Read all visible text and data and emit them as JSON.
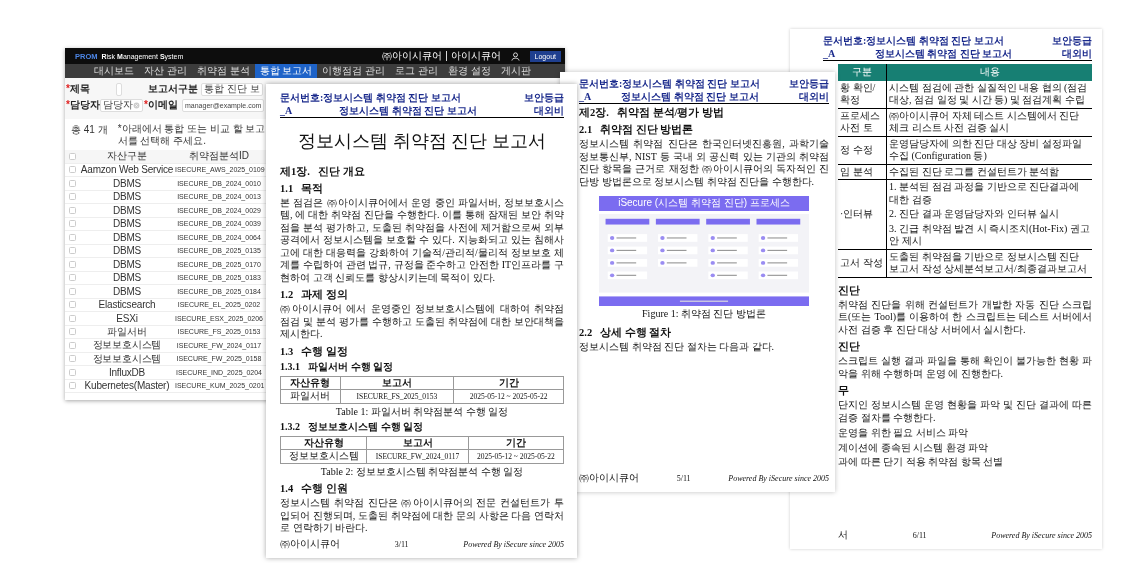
{
  "app": {
    "brand": "PROM",
    "title": "**R**isk **M**anagement **S**ystem",
    "user": "㈜아이시큐어 | 아이시큐어",
    "logout": "Logout",
    "nav": [
      {
        "label": "대시보드",
        "selected": false
      },
      {
        "label": "자산 관리",
        "selected": false
      },
      {
        "label": "취약점 분석",
        "selected": false
      },
      {
        "label": "통합 보고서",
        "selected": true
      },
      {
        "label": "이행점검 관리",
        "selected": false
      },
      {
        "label": "로그 관리",
        "selected": false
      },
      {
        "label": "환경 설정",
        "selected": false
      },
      {
        "label": "게시판",
        "selected": false
      }
    ],
    "form": [
      [
        {
          "mark": "*",
          "label": "제목",
          "kind": "input"
        },
        {
          "label": "보고서구분",
          "kind": "select",
          "value": "통합 진단 보"
        }
      ],
      [
        {
          "mark": "*",
          "label": "담당자",
          "kind": "clearable",
          "value": "담당자"
        },
        {
          "mark": "*",
          "label": "이메일",
          "kind": "input",
          "value": "manager@example.com"
        }
      ]
    ],
    "count": "총 41 개",
    "hint": "*아래에서 통합 또는 비교 할 보고서를 선택해 주세요.",
    "select_all": {
      "checked": false
    },
    "columns": [
      "자산구분",
      "취약점분석ID"
    ],
    "rows": [
      {
        "checked": false,
        "asset": "Aamzon Web Service",
        "id": "ISECURE_AWS_2025_0109"
      },
      {
        "checked": false,
        "asset": "DBMS",
        "id": "ISECURE_DB_2024_0010"
      },
      {
        "checked": false,
        "asset": "DBMS",
        "id": "ISECURE_DB_2024_0013"
      },
      {
        "checked": false,
        "asset": "DBMS",
        "id": "ISECURE_DB_2024_0029"
      },
      {
        "checked": false,
        "asset": "DBMS",
        "id": "ISECURE_DB_2024_0039"
      },
      {
        "checked": false,
        "asset": "DBMS",
        "id": "ISECURE_DB_2024_0064"
      },
      {
        "checked": false,
        "asset": "DBMS",
        "id": "ISECURE_DB_2025_0135"
      },
      {
        "checked": false,
        "asset": "DBMS",
        "id": "ISECURE_DB_2025_0170"
      },
      {
        "checked": false,
        "asset": "DBMS",
        "id": "ISECURE_DB_2025_0183"
      },
      {
        "checked": false,
        "asset": "DBMS",
        "id": "ISECURE_DB_2025_0184"
      },
      {
        "checked": false,
        "asset": "Elasticsearch",
        "id": "ISECURE_EL_2025_0202"
      },
      {
        "checked": false,
        "asset": "ESXi",
        "id": "ISECURE_ESX_2025_0206"
      },
      {
        "checked": false,
        "asset": "파일서버",
        "id": "ISECURE_FS_2025_0153"
      },
      {
        "checked": false,
        "asset": "정보보호시스템",
        "id": "ISECURE_FW_2024_0117"
      },
      {
        "checked": false,
        "asset": "정보보호시스템",
        "id": "ISECURE_FW_2025_0158"
      },
      {
        "checked": false,
        "asset": "InfluxDB",
        "id": "ISECURE_IND_2025_0204"
      },
      {
        "checked": false,
        "asset": "Kubernetes(Master)",
        "id": "ISECURE_KUM_2025_0201"
      }
    ]
  },
  "pages": [
    {
      "header": {
        "doc_no": "문서번호:정보시스템 취약점 진단 보고서",
        "doc_suffix": "_A",
        "doc_title": "정보시스템 취약점 진단 보고서",
        "grade_label": "보안등급",
        "grade": "대외비"
      },
      "title": "정보시스템 취약점 진단 보고서",
      "blocks": [
        {
          "kind": "chapter",
          "num": "제1장.",
          "text": "진단 개요"
        },
        {
          "kind": "section",
          "num": "1.1",
          "text": "목적"
        },
        {
          "kind": "para",
          "text": "본 점검은 ㈜아이시큐어에서 운영 중인 파일서버, 정보보호시스템, 에 대한 취약점 진단을 수행한다. 이를 통해 잠재된 보안 취약점을 분석 평가하고, 도출된 취약점을 사전에 제거함으로써 외부 공격에서 정보시스템을 보호할 수 있다. 지능화되고 있는 침해사고에 대한 대응력을 강화하여 기술적/관리적/물리적 정보보호 체계를 수립하여 관련 법규, 규정을 준수하고 안전한 IT인프라를 구현하여 고객 신뢰도를 향상시키는데 목적이 있다."
        },
        {
          "kind": "section",
          "num": "1.2",
          "text": "과제 정의"
        },
        {
          "kind": "para",
          "text": "㈜아이시큐어 에서 운영중인 정보보호시스템에 대하여 취약점 점검 및 분석 평가를 수행하고 도출된 취약점에 대한 보안대책을 제시한다."
        },
        {
          "kind": "section",
          "num": "1.3",
          "text": "수행 일정"
        },
        {
          "kind": "subsection",
          "num": "1.3.1",
          "text": "파일서버 수행 일정"
        },
        {
          "kind": "table",
          "columns": [
            "자산유형",
            "보고서",
            "기간"
          ],
          "rows": [
            [
              "파일서버",
              "ISECURE_FS_2025_0153",
              "2025-05-12 ~ 2025-05-22"
            ]
          ],
          "caption": "Table 1: 파일서버 취약점분석 수행 일정"
        },
        {
          "kind": "subsection",
          "num": "1.3.2",
          "text": "정보보호시스템 수행 일정"
        },
        {
          "kind": "table",
          "columns": [
            "자산유형",
            "보고서",
            "기간"
          ],
          "rows": [
            [
              "정보보호시스템",
              "ISECURE_FW_2024_0117",
              "2025-05-12 ~ 2025-05-22"
            ]
          ],
          "caption": "Table 2: 정보보호시스템 취약점분석 수행 일정"
        },
        {
          "kind": "section",
          "num": "1.4",
          "text": "수행 인원"
        },
        {
          "kind": "para",
          "text": "정보시스템 취약점 진단은 ㈜아이시큐어의 전문 컨설턴트가 투입되어 진행되며, 도출된 취약점에 대한 문의 사항은 다음 연락처로 연락하기 바란다."
        }
      ],
      "footer": {
        "left": "㈜아이시큐어",
        "page": "3/11",
        "right": "Powered By iSecure since 2005"
      }
    },
    {
      "header": {
        "doc_no": "문서번호:정보시스템 취약점 진단 보고서",
        "doc_suffix": "_A",
        "doc_title": "정보시스템 취약점 진단 보고서",
        "grade_label": "보안등급",
        "grade": "대외비"
      },
      "blocks": [
        {
          "kind": "chapter",
          "num": "제2장.",
          "text": "취약점 분석/평가 방법"
        },
        {
          "kind": "section",
          "num": "2.1",
          "text": "취약점 진단 방법론"
        },
        {
          "kind": "para",
          "text": "정보시스템 취약점 진단은 한국인터넷진흥원, 과학기술정보통신부, NIST 등 국내 외 공신력 있는 기관의 취약점 진단 항목을 근거로 재정한 ㈜아이시큐어의 독자적인 진단방 방법론으로 정보시스템 취약점 진단을 수행한다."
        },
        {
          "kind": "figure",
          "title": "iSecure (시스템 취약점 진단) 프로세스",
          "caption": "Figure 1: 취약점 진단 방법론"
        },
        {
          "kind": "section",
          "num": "2.2",
          "text": "상세 수행 절차"
        },
        {
          "kind": "para",
          "text": "정보시스템 취약점 진단 절차는 다음과 같다."
        }
      ],
      "footer": {
        "left": "㈜아이시큐어",
        "page": "5/11",
        "right": "Powered By iSecure since 2005"
      }
    },
    {
      "header": {
        "doc_no": "문서번호:정보시스템 취약점 진단 보고서",
        "doc_suffix": "_A",
        "doc_title": "정보시스템 취약점 진단 보고서",
        "grade_label": "보안등급",
        "grade": "대외비"
      },
      "blocks": [
        {
          "kind": "grid",
          "columns": [
            "구분",
            "내용"
          ],
          "rows": [
            {
              "label": "황 확인/확정",
              "lines": [
                "시스템 점검에 관한 실질적인 내용 협의 (점검 대상, 점검 일정 및 시간 등) 및 점검계획 수립"
              ]
            },
            {
              "label": "프로세스 사전 토",
              "lines": [
                "㈜아이시큐어 자체 테스트 시스템에서 진단 체크 리스트 사전 검증 실시"
              ]
            },
            {
              "label": "정 수정",
              "lines": [
                "운영담당자에 의한 진단 대상 장비 설정파일 수집 (Configuration 등)"
              ]
            },
            {
              "label": "임 분석",
              "lines": [
                "수집된 진단 로그를 컨설턴트가 분석함"
              ]
            },
            {
              "label": "·인터뷰",
              "lines": [
                "1. 분석된 점검 과정을 기반으로 진단결과에 대한 검증",
                "2. 진단 결과 운영담당자와 인터뷰 실시",
                "3. 긴급 취약점 발견 시 즉시조치(Hot-Fix) 권고안 제시"
              ]
            },
            {
              "label": "고서 작성",
              "lines": [
                "도출된 취약점을 기반으로 정보시스템 진단 보고서 작성 상세분석보고서/최종결과보고서"
              ]
            }
          ]
        },
        {
          "kind": "section",
          "text": "진단"
        },
        {
          "kind": "para",
          "text": "취약점 진단을 위해 컨설턴트가 개발한 자동 진단 스크립트(또는 Tool)를 이용하여 한 스크립트는 테스트 서버에서 사전 검증 후 진단 대상 서버에서 실시한다."
        },
        {
          "kind": "section",
          "text": "진단"
        },
        {
          "kind": "para",
          "text": "스크립트 실행 결과 파일을 통해 확인이 불가능한 현황 파악을 위해 수행하며 운영 에 진행한다."
        },
        {
          "kind": "section",
          "text": "무"
        },
        {
          "kind": "para",
          "text": "단지인 정보시스템 운영 현황을 파악 및 진단 결과에 따른 검증 절차를 수행한다."
        },
        {
          "kind": "line",
          "text": "운영을 위한 필요 서비스 파악"
        },
        {
          "kind": "line",
          "text": "계이션에 종속된 시스템 환경 파악"
        },
        {
          "kind": "line",
          "text": "과에 따른 단기 적용 취약점 항목 선별"
        }
      ],
      "footer": {
        "left": "서",
        "page": "6/11",
        "right": "Powered By iSecure since 2005"
      }
    }
  ]
}
